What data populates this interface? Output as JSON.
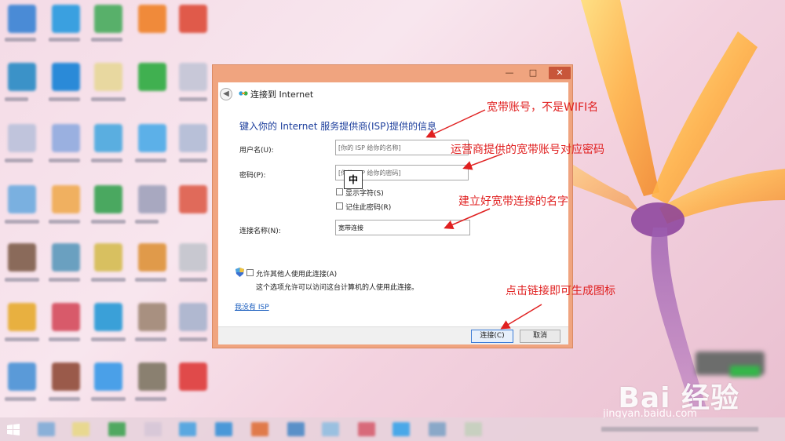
{
  "window": {
    "title": "连接到 Internet",
    "heading": "键入你的 Internet 服务提供商(ISP)提供的信息",
    "minimize_glyph": "—",
    "maximize_glyph": "□",
    "close_glyph": "✕"
  },
  "form": {
    "username_label": "用户名(U):",
    "username_placeholder": "[你的 ISP 给你的名称]",
    "password_label": "密码(P):",
    "password_placeholder": "[你的 ISP 给你的密码]",
    "show_chars_label": "显示字符(S)",
    "remember_password_label": "记住此密码(R)",
    "connection_name_label": "连接名称(N):",
    "connection_name_value": "宽带连接",
    "allow_others_label": "允许其他人使用此连接(A)",
    "allow_others_desc": "这个选项允许可以访问这台计算机的人使用此连接。",
    "no_isp_link": "我没有 ISP",
    "connect_button": "连接(C)",
    "cancel_button": "取消",
    "ime_indicator": "中"
  },
  "annotations": {
    "username_note": "宽带账号，不是WIFI名",
    "password_note": "运营商提供的宽带账号对应密码",
    "connection_name_note": "建立好宽带连接的名字",
    "connect_note": "点击链接即可生成图标"
  },
  "watermark": {
    "brand": "Bai 经验",
    "url": "jingyan.baidu.com"
  },
  "colors": {
    "dialog_frame": "#f0a47f",
    "heading": "#1c3e9c",
    "annotation": "#e02020",
    "link": "#1c5fbf"
  }
}
